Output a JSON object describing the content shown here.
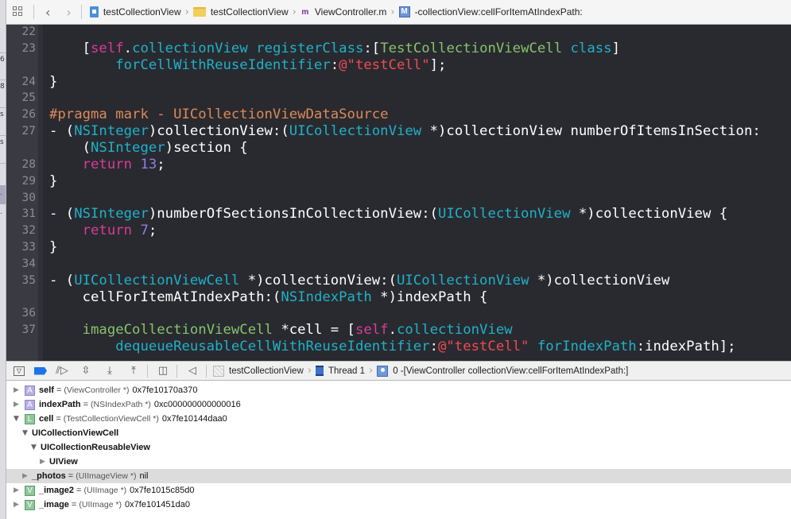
{
  "jumpbar": {
    "back_icon": "chevron-left-icon",
    "forward_icon": "chevron-right-icon",
    "crumbs": [
      {
        "label": "testCollectionView",
        "icon": "project-icon"
      },
      {
        "label": "testCollectionView",
        "icon": "folder-icon"
      },
      {
        "label": "ViewController.m",
        "icon": "objc-m-file-icon",
        "icon_glyph": "m"
      },
      {
        "label": "-collectionView:cellForItemAtIndexPath:",
        "icon": "method-icon",
        "icon_glyph": "M"
      }
    ]
  },
  "editor": {
    "line_numbers": [
      "22",
      "23",
      "24",
      "25",
      "26",
      "27",
      "28",
      "29",
      "30",
      "31",
      "32",
      "33",
      "34",
      "35",
      "36",
      "37"
    ],
    "lines": [
      {
        "num": "22",
        "tokens": []
      },
      {
        "num": "23",
        "tokens": [
          [
            "plain",
            "    ["
          ],
          [
            "kw",
            "self"
          ],
          [
            "plain",
            "."
          ],
          [
            "prop",
            "collectionView"
          ],
          [
            "plain",
            " "
          ],
          [
            "prop",
            "registerClass"
          ],
          [
            "plain",
            ":["
          ],
          [
            "cls",
            "TestCollectionViewCell"
          ],
          [
            "plain",
            " "
          ],
          [
            "prop",
            "class"
          ],
          [
            "plain",
            "]"
          ]
        ]
      },
      {
        "num": "",
        "tokens": [
          [
            "plain",
            "        "
          ],
          [
            "prop",
            "forCellWithReuseIdentifier"
          ],
          [
            "plain",
            ":"
          ],
          [
            "str",
            "@\"testCell\""
          ],
          [
            "plain",
            "];"
          ]
        ]
      },
      {
        "num": "24",
        "tokens": [
          [
            "plain",
            "}"
          ]
        ]
      },
      {
        "num": "25",
        "tokens": []
      },
      {
        "num": "26",
        "tokens": [
          [
            "pragma",
            "#pragma mark - UICollectionViewDataSource"
          ]
        ]
      },
      {
        "num": "27",
        "tokens": [
          [
            "plain",
            "- ("
          ],
          [
            "type",
            "NSInteger"
          ],
          [
            "plain",
            ")collectionView:("
          ],
          [
            "type",
            "UICollectionView"
          ],
          [
            "plain",
            " *)collectionView numberOfItemsInSection:"
          ]
        ]
      },
      {
        "num": "",
        "tokens": [
          [
            "plain",
            "    ("
          ],
          [
            "type",
            "NSInteger"
          ],
          [
            "plain",
            ")section {"
          ]
        ]
      },
      {
        "num": "28",
        "tokens": [
          [
            "plain",
            "    "
          ],
          [
            "kw",
            "return"
          ],
          [
            "plain",
            " "
          ],
          [
            "num",
            "13"
          ],
          [
            "plain",
            ";"
          ]
        ]
      },
      {
        "num": "29",
        "tokens": [
          [
            "plain",
            "}"
          ]
        ]
      },
      {
        "num": "30",
        "tokens": []
      },
      {
        "num": "31",
        "tokens": [
          [
            "plain",
            "- ("
          ],
          [
            "type",
            "NSInteger"
          ],
          [
            "plain",
            ")numberOfSectionsInCollectionView:("
          ],
          [
            "type",
            "UICollectionView"
          ],
          [
            "plain",
            " *)collectionView {"
          ]
        ]
      },
      {
        "num": "32",
        "tokens": [
          [
            "plain",
            "    "
          ],
          [
            "kw",
            "return"
          ],
          [
            "plain",
            " "
          ],
          [
            "num",
            "7"
          ],
          [
            "plain",
            ";"
          ]
        ]
      },
      {
        "num": "33",
        "tokens": [
          [
            "plain",
            "}"
          ]
        ]
      },
      {
        "num": "34",
        "tokens": []
      },
      {
        "num": "35",
        "tokens": [
          [
            "plain",
            "- ("
          ],
          [
            "type",
            "UICollectionViewCell"
          ],
          [
            "plain",
            " *)collectionView:("
          ],
          [
            "type",
            "UICollectionView"
          ],
          [
            "plain",
            " *)collectionView"
          ]
        ]
      },
      {
        "num": "",
        "tokens": [
          [
            "plain",
            "    cellForItemAtIndexPath:("
          ],
          [
            "type",
            "NSIndexPath"
          ],
          [
            "plain",
            " *)indexPath {"
          ]
        ]
      },
      {
        "num": "36",
        "tokens": []
      },
      {
        "num": "37",
        "tokens": [
          [
            "plain",
            "    "
          ],
          [
            "cls",
            "imageCollectionViewCell"
          ],
          [
            "plain",
            " *cell = ["
          ],
          [
            "kw",
            "self"
          ],
          [
            "plain",
            "."
          ],
          [
            "prop",
            "collectionView"
          ]
        ]
      },
      {
        "num": "",
        "tokens": [
          [
            "plain",
            "        "
          ],
          [
            "prop",
            "dequeueReusableCellWithReuseIdentifier"
          ],
          [
            "plain",
            ":"
          ],
          [
            "str",
            "@\"testCell\""
          ],
          [
            "plain",
            " "
          ],
          [
            "prop",
            "forIndexPath"
          ],
          [
            "plain",
            ":indexPath];"
          ]
        ]
      }
    ],
    "colors": {
      "background": "#292a30",
      "keyword": "#d93b96",
      "property": "#1fb1c8",
      "class": "#86c36a",
      "string": "#f04a52",
      "number": "#8b80e0",
      "pragma": "#dd8a57"
    }
  },
  "debugbar": {
    "buttons": [
      "hide-debug-area",
      "breakpoints-toggle",
      "continue",
      "step-over",
      "step-into",
      "step-out",
      "view-debugger",
      "simulate-location"
    ],
    "crumbs": [
      {
        "label": "testCollectionView",
        "icon": "app-icon"
      },
      {
        "label": "Thread 1",
        "icon": "thread-icon"
      },
      {
        "label": "0 -[ViewController collectionView:cellForItemAtIndexPath:]",
        "icon": "stack-frame-icon"
      }
    ],
    "breakpoint_color": "#1b74e8"
  },
  "variables": [
    {
      "indent": 0,
      "expander": "collapsed",
      "badge": "A",
      "name": "self",
      "type": "(ViewController *)",
      "value": "0x7fe10170a370",
      "selected": false
    },
    {
      "indent": 0,
      "expander": "collapsed",
      "badge": "A",
      "name": "indexPath",
      "type": "(NSIndexPath *)",
      "value": "0xc000000000000016",
      "selected": false
    },
    {
      "indent": 0,
      "expander": "expanded",
      "badge": "L",
      "name": "cell",
      "type": "(TestCollectionViewCell *)",
      "value": "0x7fe10144daa0",
      "selected": false
    },
    {
      "indent": 1,
      "expander": "expanded",
      "badge": "",
      "name": "UICollectionViewCell",
      "type": "",
      "value": "",
      "selected": false
    },
    {
      "indent": 2,
      "expander": "expanded",
      "badge": "",
      "name": "UICollectionReusableView",
      "type": "",
      "value": "",
      "selected": false
    },
    {
      "indent": 3,
      "expander": "collapsed",
      "badge": "",
      "name": "UIView",
      "type": "",
      "value": "",
      "selected": false
    },
    {
      "indent": 1,
      "expander": "collapsed",
      "badge": "",
      "name": "_photos",
      "type": "(UIImageView *)",
      "value": "nil",
      "selected": true
    },
    {
      "indent": 0,
      "expander": "collapsed",
      "badge": "V",
      "name": "_image2",
      "type": "(UIImage *)",
      "value": "0x7fe1015c85d0",
      "selected": false
    },
    {
      "indent": 0,
      "expander": "collapsed",
      "badge": "V",
      "name": "_image",
      "type": "(UIImage *)",
      "value": "0x7fe101451da0",
      "selected": false
    }
  ],
  "sidebar_fragments": [
    "6",
    "8",
    "s",
    "s",
    ".",
    "."
  ]
}
